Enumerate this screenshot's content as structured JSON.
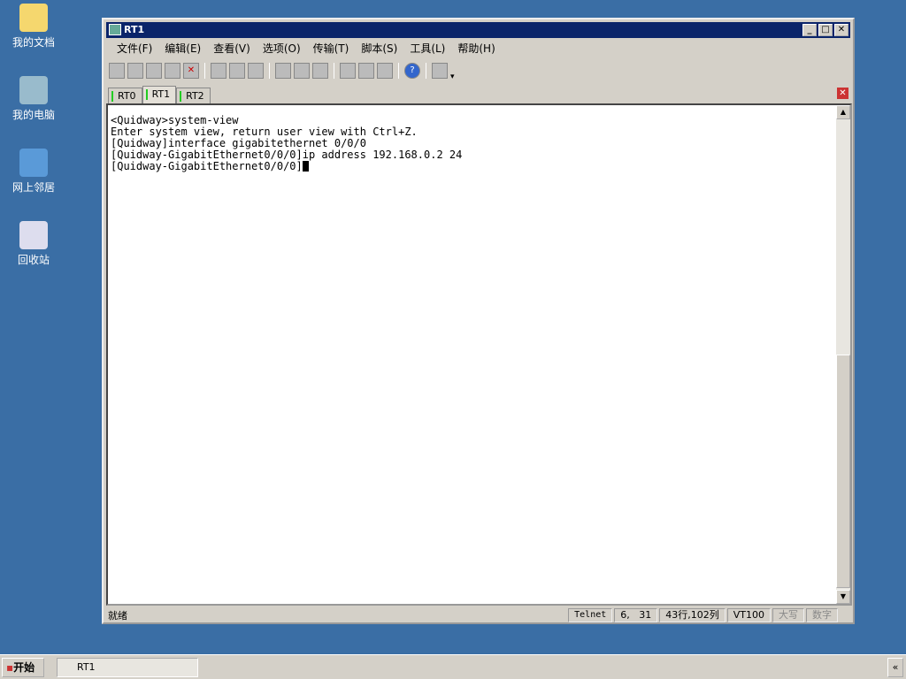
{
  "desktop": {
    "icons": [
      {
        "label": "我的文档"
      },
      {
        "label": "我的电脑"
      },
      {
        "label": "网上邻居"
      },
      {
        "label": "回收站"
      }
    ]
  },
  "window": {
    "title": "RT1",
    "menu": [
      "文件(F)",
      "编辑(E)",
      "查看(V)",
      "选项(O)",
      "传输(T)",
      "脚本(S)",
      "工具(L)",
      "帮助(H)"
    ],
    "tabs": [
      "RT0",
      "RT1",
      "RT2"
    ],
    "terminal": [
      "<Quidway>system-view",
      "Enter system view, return user view with Ctrl+Z.",
      "[Quidway]interface gigabitethernet 0/0/0",
      "[Quidway-GigabitEthernet0/0/0]ip address 192.168.0.2 24",
      "[Quidway-GigabitEthernet0/0/0]"
    ],
    "status": {
      "ready": "就绪",
      "protocol": "Telnet",
      "cursor": "6,   31",
      "size": "43行,102列",
      "emulation": "VT100",
      "caps": "大写",
      "num": "数字"
    }
  },
  "taskbar": {
    "start": "开始",
    "task": "RT1",
    "tray": "«"
  }
}
